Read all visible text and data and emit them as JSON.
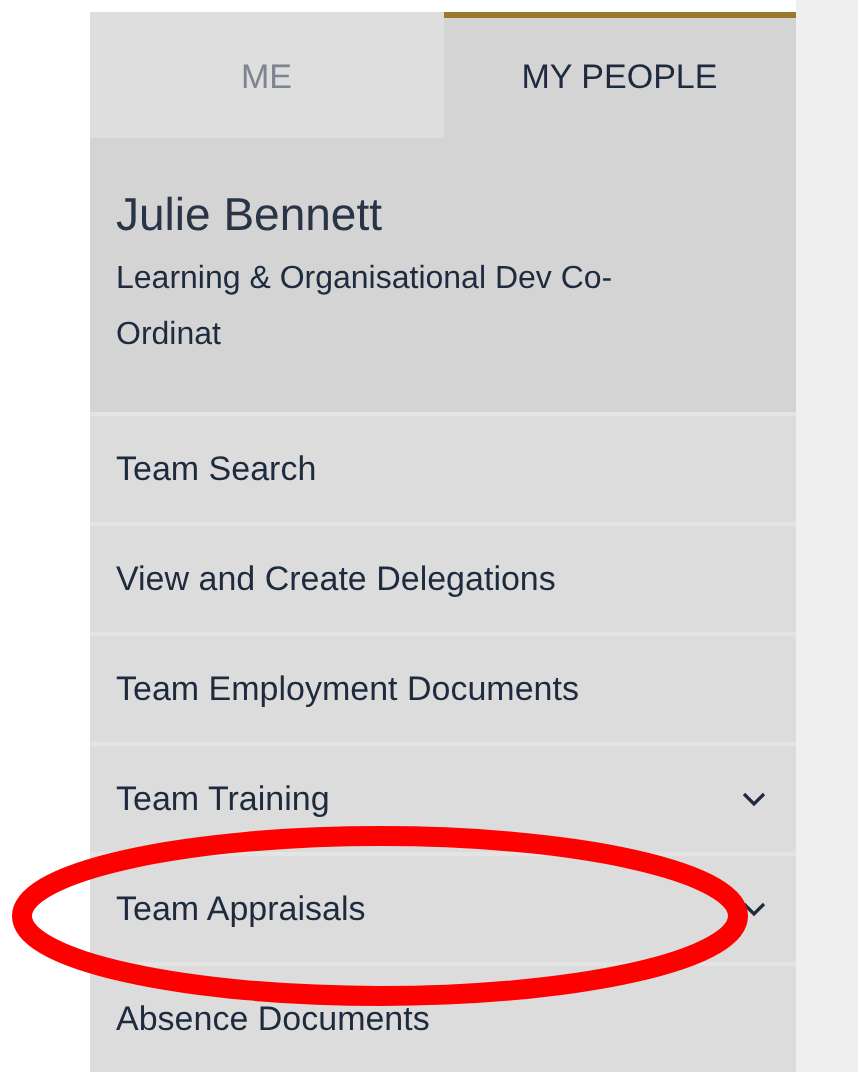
{
  "tabs": [
    {
      "label": "ME",
      "selected": false
    },
    {
      "label": "MY PEOPLE",
      "selected": true
    }
  ],
  "profile": {
    "name": "Julie Bennett",
    "role": "Learning & Organisational Dev Co-Ordinat"
  },
  "menu": [
    {
      "label": "Team Search",
      "expandable": false
    },
    {
      "label": "View and Create Delegations",
      "expandable": false
    },
    {
      "label": "Team Employment Documents",
      "expandable": false
    },
    {
      "label": "Team Training",
      "expandable": true
    },
    {
      "label": "Team Appraisals",
      "expandable": true
    },
    {
      "label": "Absence Documents",
      "expandable": false
    }
  ],
  "highlight": {
    "kind": "ellipse"
  }
}
